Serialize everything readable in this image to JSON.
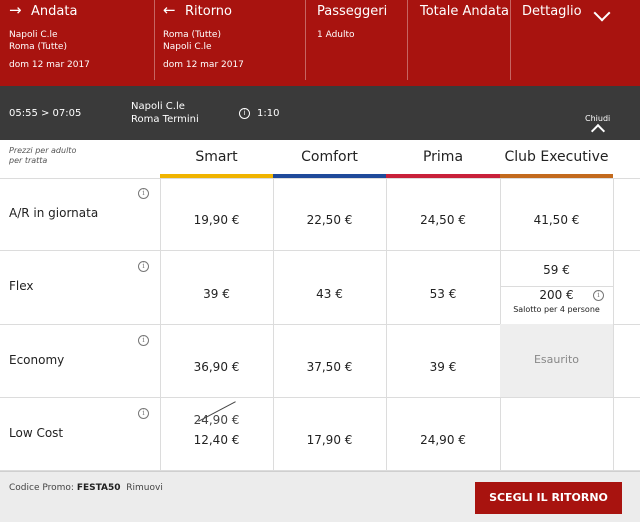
{
  "header": {
    "andata": {
      "title": "Andata",
      "from": "Napoli C.le",
      "to": "Roma (Tutte)",
      "date": "dom 12 mar 2017"
    },
    "ritorno": {
      "title": "Ritorno",
      "from": "Roma (Tutte)",
      "to": "Napoli C.le",
      "date": "dom 12 mar 2017"
    },
    "passeggeri": {
      "title": "Passeggeri",
      "value": "1 Adulto"
    },
    "totale": {
      "title": "Totale Andata"
    },
    "dettaglio": {
      "title": "Dettaglio"
    },
    "icons": {
      "andata": "arrow-right-icon",
      "ritorno": "arrow-left-icon",
      "expand": "chevron-down-icon"
    }
  },
  "train": {
    "times": "05:55 > 07:05",
    "from": "Napoli C.le",
    "to": "Roma Termini",
    "duration": "1:10",
    "close_label": "Chiudi"
  },
  "table": {
    "note_line1": "Prezzi per adulto",
    "note_line2": "per tratta",
    "columns": [
      {
        "name": "Smart",
        "color": "#f0b400"
      },
      {
        "name": "Comfort",
        "color": "#1f4a9a"
      },
      {
        "name": "Prima",
        "color": "#c8203a"
      },
      {
        "name": "Club Executive",
        "color": "#c36a1d"
      }
    ],
    "rows": [
      {
        "label": "A/R in giornata",
        "prices": [
          "19,90 €",
          "22,50 €",
          "24,50 €",
          "41,50 €"
        ]
      },
      {
        "label": "Flex",
        "prices": [
          "39 €",
          "43 €",
          "53 €",
          "59 €"
        ],
        "extra_price": "200 €",
        "extra_note": "Salotto per 4 persone"
      },
      {
        "label": "Economy",
        "prices": [
          "36,90 €",
          "37,50 €",
          "39 €"
        ],
        "sold_out": "Esaurito"
      },
      {
        "label": "Low Cost",
        "old_price": "24,90 €",
        "prices": [
          "12,40 €",
          "17,90 €",
          "24,90 €"
        ]
      }
    ]
  },
  "footer": {
    "promo_label": "Codice Promo:",
    "promo_code": "FESTA50",
    "remove_label": "Rimuovi",
    "cta_label": "SCEGLI IL RITORNO"
  }
}
